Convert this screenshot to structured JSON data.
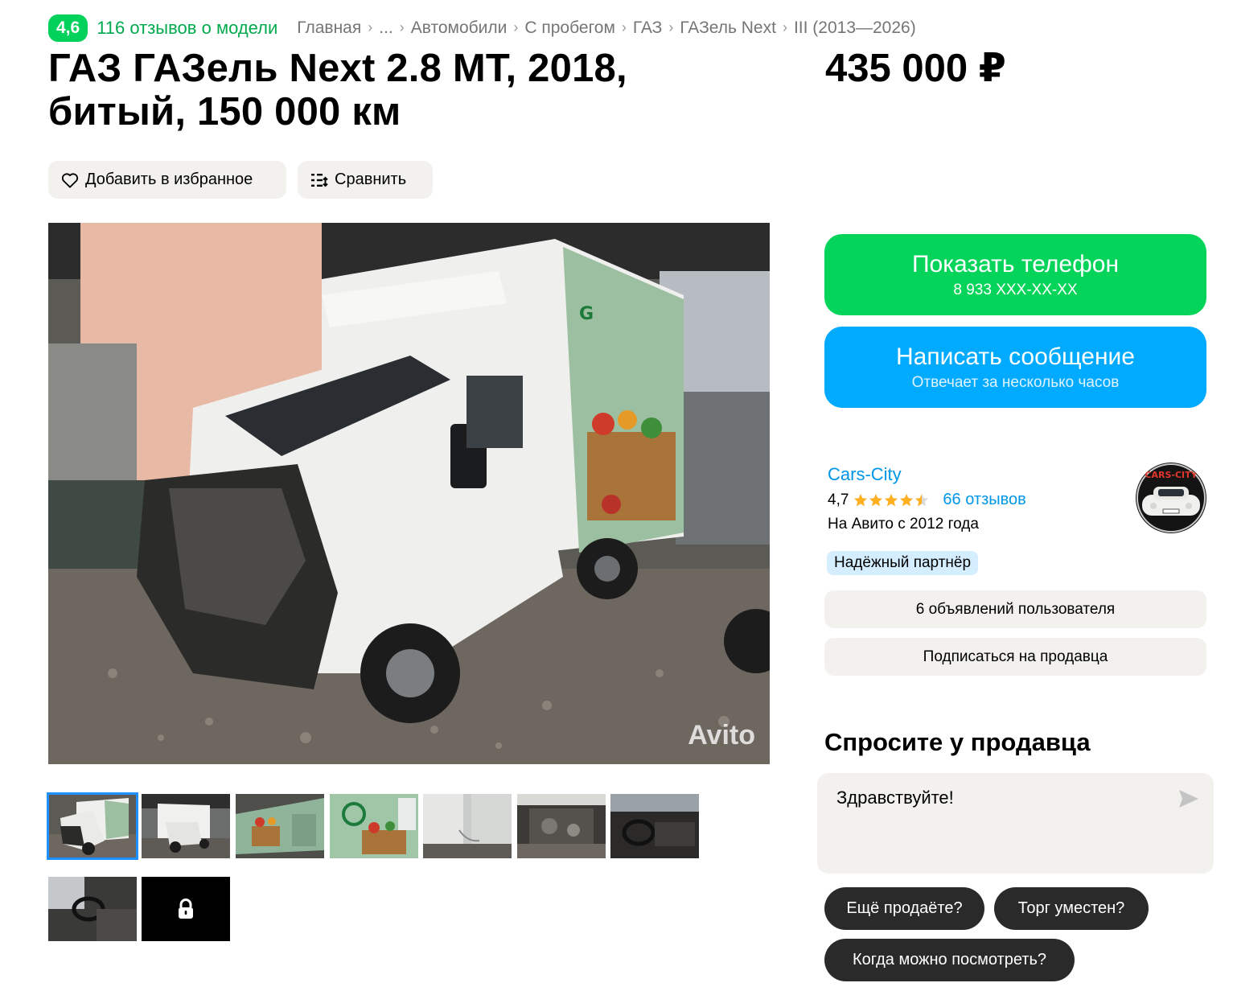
{
  "model_rating": {
    "score": "4,6",
    "reviews": "116 отзывов о модели"
  },
  "breadcrumbs": [
    "Главная",
    "...",
    "Автомобили",
    "С пробегом",
    "ГАЗ",
    "ГАЗель Next",
    "III (2013—2026)"
  ],
  "listing": {
    "title": "ГАЗ ГАЗель Next 2.8 MT, 2018, битый, 150 000 км",
    "price": "435 000 ₽"
  },
  "actions": {
    "favorite": "Добавить в избранное",
    "compare": "Сравнить"
  },
  "gallery": {
    "watermark": "Avito",
    "thumb_count": 9,
    "active_index": 0
  },
  "contact": {
    "show_phone": "Показать телефон",
    "phone_masked": "8 933 XXX-XX-XX",
    "write_message": "Написать сообщение",
    "response_time": "Отвечает за несколько часов"
  },
  "seller": {
    "name": "Cars-City",
    "rating": "4,7",
    "stars": 4.5,
    "reviews": "66 отзывов",
    "since": "На Авито с 2012 года",
    "badge": "Надёжный партнёр",
    "listings_button": "6 объявлений пользователя",
    "subscribe_button": "Подписаться на продавца",
    "avatar_text": "CARS-CITY"
  },
  "ask": {
    "title": "Спросите у продавца",
    "message": "Здравствуйте!",
    "chips": [
      "Ещё продаёте?",
      "Торг уместен?",
      "Когда можно посмотреть?"
    ]
  },
  "colors": {
    "green": "#04d45a",
    "blue": "#00aaff",
    "link": "#0096e8",
    "chip": "#2a2a2a",
    "gray_button": "#f2f1ed"
  }
}
